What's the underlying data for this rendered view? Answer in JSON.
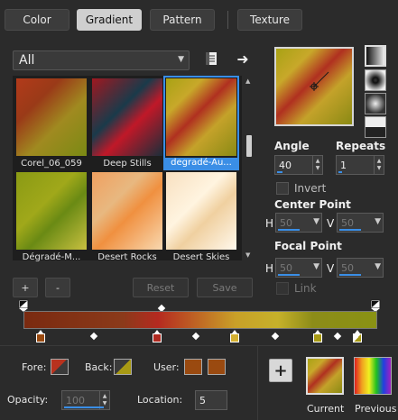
{
  "tabs": [
    {
      "label": "Color"
    },
    {
      "label": "Gradient"
    },
    {
      "label": "Pattern"
    },
    {
      "label": "Texture"
    }
  ],
  "active_tab": "Gradient",
  "library": {
    "category": "All",
    "add_label": "+",
    "remove_label": "-",
    "reset_label": "Reset",
    "save_label": "Save",
    "items": [
      {
        "label": "Corel_06_059"
      },
      {
        "label": "Deep Stills"
      },
      {
        "label": "degradé-Au..."
      },
      {
        "label": "Dégradé-M..."
      },
      {
        "label": "Desert Rocks"
      },
      {
        "label": "Desert Skies"
      }
    ],
    "selected": "degradé-Au..."
  },
  "settings": {
    "angle_label": "Angle",
    "angle_value": "40",
    "repeats_label": "Repeats",
    "repeats_value": "1",
    "invert_label": "Invert",
    "center_point_label": "Center Point",
    "focal_point_label": "Focal Point",
    "h_label": "H",
    "v_label": "V",
    "center_h": "50",
    "center_v": "50",
    "focal_h": "50",
    "focal_v": "50",
    "link_label": "Link"
  },
  "editor": {
    "fore_label": "Fore:",
    "back_label": "Back:",
    "user_label": "User:",
    "opacity_label": "Opacity:",
    "opacity_value": "100",
    "location_label": "Location:",
    "location_value": "5",
    "add_label": "+",
    "current_label": "Current",
    "previous_label": "Previous"
  },
  "colors": {
    "fore": "#b8321e",
    "back": "#a89a14",
    "user1": "#9a4a10",
    "user2": "#9a4a10",
    "accent": "#3a8ee6"
  }
}
